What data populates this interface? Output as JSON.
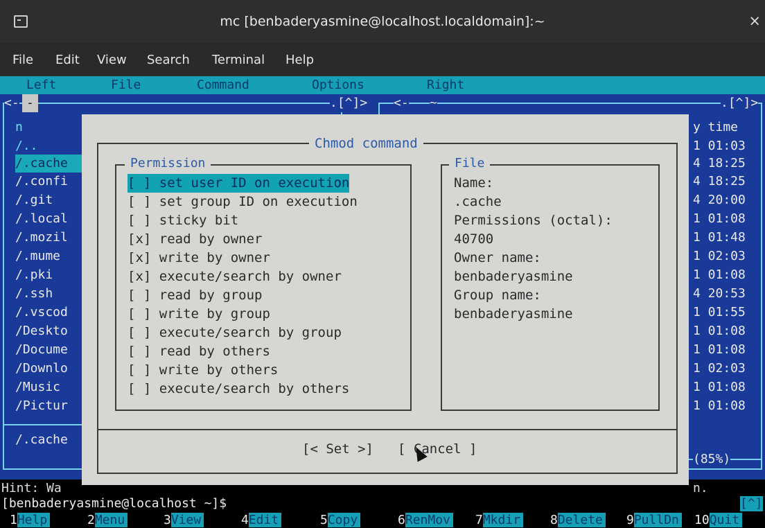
{
  "window": {
    "title": "mc [benbaderyasmine@localhost.localdomain]:~",
    "close": "×"
  },
  "term_menu": [
    "File",
    "Edit",
    "View",
    "Search",
    "Terminal",
    "Help"
  ],
  "mc_menu": [
    "Left",
    "File",
    "Command",
    "Options",
    "Right"
  ],
  "left_panel": {
    "header_left": "<-",
    "header_mid": "-",
    "header_right": ".[^]>",
    "items": [
      "n",
      "/..",
      "/.cache",
      "/.confi",
      "/.git",
      "/.local",
      "/.mozil",
      "/.mume",
      "/.pki",
      "/.ssh",
      "/.vscod",
      "/Deskto",
      "/Docume",
      "/Downlo",
      "/Music",
      "/Pictur"
    ],
    "status": "/.cache"
  },
  "right_panel": {
    "header_left": "<-",
    "header_mid": "~",
    "header_right": ".[^]>",
    "col_header": "y time",
    "times": [
      "1 01:03",
      "4 18:25",
      "4 18:25",
      "4 20:00",
      "1 01:08",
      "1 01:48",
      "1 02:03",
      "1 01:08",
      "4 20:53",
      "1 01:55",
      "1 01:08",
      "1 01:08",
      "1 02:03",
      "1 01:08",
      "1 01:08"
    ],
    "percent": "(85%)"
  },
  "dialog": {
    "title": "Chmod command",
    "permission_label": "Permission",
    "file_label": "File",
    "permissions": [
      {
        "box": "[ ]",
        "text": "set user ID on execution"
      },
      {
        "box": "[ ]",
        "text": "set group ID on execution"
      },
      {
        "box": "[ ]",
        "text": "sticky bit"
      },
      {
        "box": "[x]",
        "text": "read by owner"
      },
      {
        "box": "[x]",
        "text": "write by owner"
      },
      {
        "box": "[x]",
        "text": "execute/search by owner"
      },
      {
        "box": "[ ]",
        "text": "read by group"
      },
      {
        "box": "[ ]",
        "text": "write by group"
      },
      {
        "box": "[ ]",
        "text": "execute/search by group"
      },
      {
        "box": "[ ]",
        "text": "read by others"
      },
      {
        "box": "[ ]",
        "text": "write by others"
      },
      {
        "box": "[ ]",
        "text": "execute/search by others"
      }
    ],
    "file_info": {
      "name_label": "Name:",
      "name": ".cache",
      "perm_label": "Permissions (octal):",
      "perm": "40700",
      "owner_label": "Owner name:",
      "owner": "benbaderyasmine",
      "group_label": "Group name:",
      "group": "benbaderyasmine"
    },
    "set_button": "[< Set >]",
    "cancel_button": "[ Cancel ]"
  },
  "hint": {
    "left": "Hint: Wa",
    "right": "n."
  },
  "prompt": {
    "text": "[benbaderyasmine@localhost ~]$",
    "right": "[^]"
  },
  "fkeys": [
    {
      "num": "1",
      "label": "Help"
    },
    {
      "num": "2",
      "label": "Menu"
    },
    {
      "num": "3",
      "label": "View"
    },
    {
      "num": "4",
      "label": "Edit"
    },
    {
      "num": "5",
      "label": "Copy"
    },
    {
      "num": "6",
      "label": "RenMov"
    },
    {
      "num": "7",
      "label": "Mkdir"
    },
    {
      "num": "8",
      "label": "Delete"
    },
    {
      "num": "9",
      "label": "PullDn"
    },
    {
      "num": "10",
      "label": "Quit"
    }
  ],
  "colors": {
    "mc_bg": "#1a3a9a",
    "mc_cyan": "#15a0b8",
    "dialog_bg": "#d6d6d3"
  }
}
